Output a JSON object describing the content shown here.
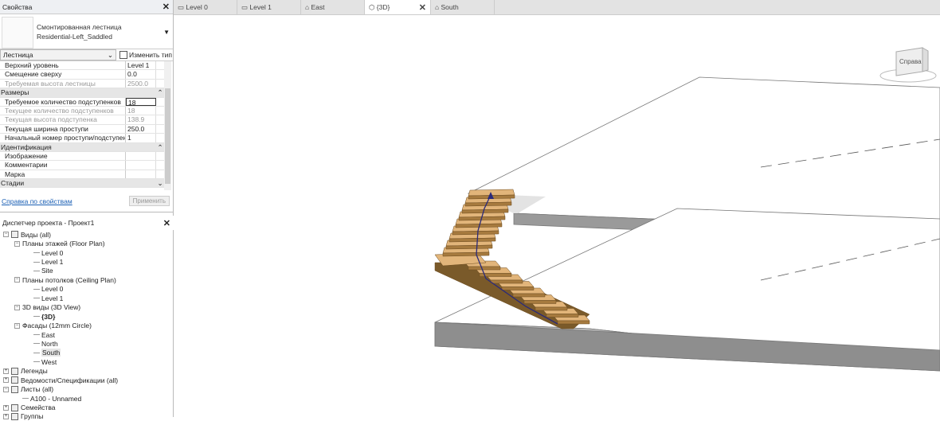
{
  "properties": {
    "title": "Свойства",
    "type_line1": "Смонтированная лестница",
    "type_line2": "Residential-Left_Saddled",
    "category": "Лестница",
    "edit_type": "Изменить тип",
    "rows": [
      {
        "kind": "p",
        "name": "Верхний уровень",
        "value": "Level 1"
      },
      {
        "kind": "p",
        "name": "Смещение сверху",
        "value": "0.0"
      },
      {
        "kind": "d",
        "name": "Требуемая высота лестницы",
        "value": "2500.0"
      },
      {
        "kind": "g",
        "name": "Размеры",
        "toggle": "⌃"
      },
      {
        "kind": "i",
        "name": "Требуемое количество подступенков",
        "value": "18"
      },
      {
        "kind": "d",
        "name": "Текущее количество подступенков",
        "value": "18"
      },
      {
        "kind": "d",
        "name": "Текущая высота подступенка",
        "value": "138.9"
      },
      {
        "kind": "p",
        "name": "Текущая ширина проступи",
        "value": "250.0"
      },
      {
        "kind": "p",
        "name": "Начальный номер проступи/подступенка",
        "value": "1"
      },
      {
        "kind": "g",
        "name": "Идентификация",
        "toggle": "⌃"
      },
      {
        "kind": "p",
        "name": "Изображение",
        "value": ""
      },
      {
        "kind": "p",
        "name": "Комментарии",
        "value": ""
      },
      {
        "kind": "p",
        "name": "Марка",
        "value": ""
      },
      {
        "kind": "g",
        "name": "Стадии",
        "toggle": "⌄"
      }
    ],
    "help": "Справка по свойствам",
    "apply": "Применить"
  },
  "browser": {
    "title": "Диспетчер проекта - Проект1",
    "items": [
      {
        "l": 0,
        "tog": "−",
        "icon": "views",
        "t": "Виды (all)"
      },
      {
        "l": 1,
        "tog": "−",
        "t": "Планы этажей (Floor Plan)"
      },
      {
        "l": 2,
        "t": "Level 0"
      },
      {
        "l": 2,
        "t": "Level 1"
      },
      {
        "l": 2,
        "t": "Site"
      },
      {
        "l": 1,
        "tog": "−",
        "t": "Планы потолков (Ceiling Plan)"
      },
      {
        "l": 2,
        "t": "Level 0"
      },
      {
        "l": 2,
        "t": "Level 1"
      },
      {
        "l": 1,
        "tog": "−",
        "t": "3D виды (3D View)"
      },
      {
        "l": 2,
        "t": "{3D}",
        "bold": true
      },
      {
        "l": 1,
        "tog": "−",
        "t": "Фасады (12mm Circle)"
      },
      {
        "l": 2,
        "t": "East"
      },
      {
        "l": 2,
        "t": "North"
      },
      {
        "l": 2,
        "t": "South",
        "sel": true
      },
      {
        "l": 2,
        "t": "West"
      },
      {
        "l": 0,
        "tog": "+",
        "icon": "legend",
        "t": "Легенды"
      },
      {
        "l": 0,
        "tog": "+",
        "icon": "schedule",
        "t": "Ведомости/Спецификации (all)"
      },
      {
        "l": 0,
        "tog": "−",
        "icon": "sheet",
        "t": "Листы (all)"
      },
      {
        "l": 1,
        "t": "A100 - Unnamed"
      },
      {
        "l": 0,
        "tog": "+",
        "icon": "family",
        "t": "Семейства"
      },
      {
        "l": 0,
        "tog": "+",
        "icon": "group",
        "t": "Группы"
      }
    ]
  },
  "tabs": [
    {
      "label": "Level 0",
      "icon": "plan"
    },
    {
      "label": "Level 1",
      "icon": "plan"
    },
    {
      "label": "East",
      "icon": "elevation"
    },
    {
      "label": "{3D}",
      "icon": "3d",
      "active": true
    },
    {
      "label": "South",
      "icon": "elevation"
    }
  ],
  "viewcube": {
    "face": "Справа"
  }
}
